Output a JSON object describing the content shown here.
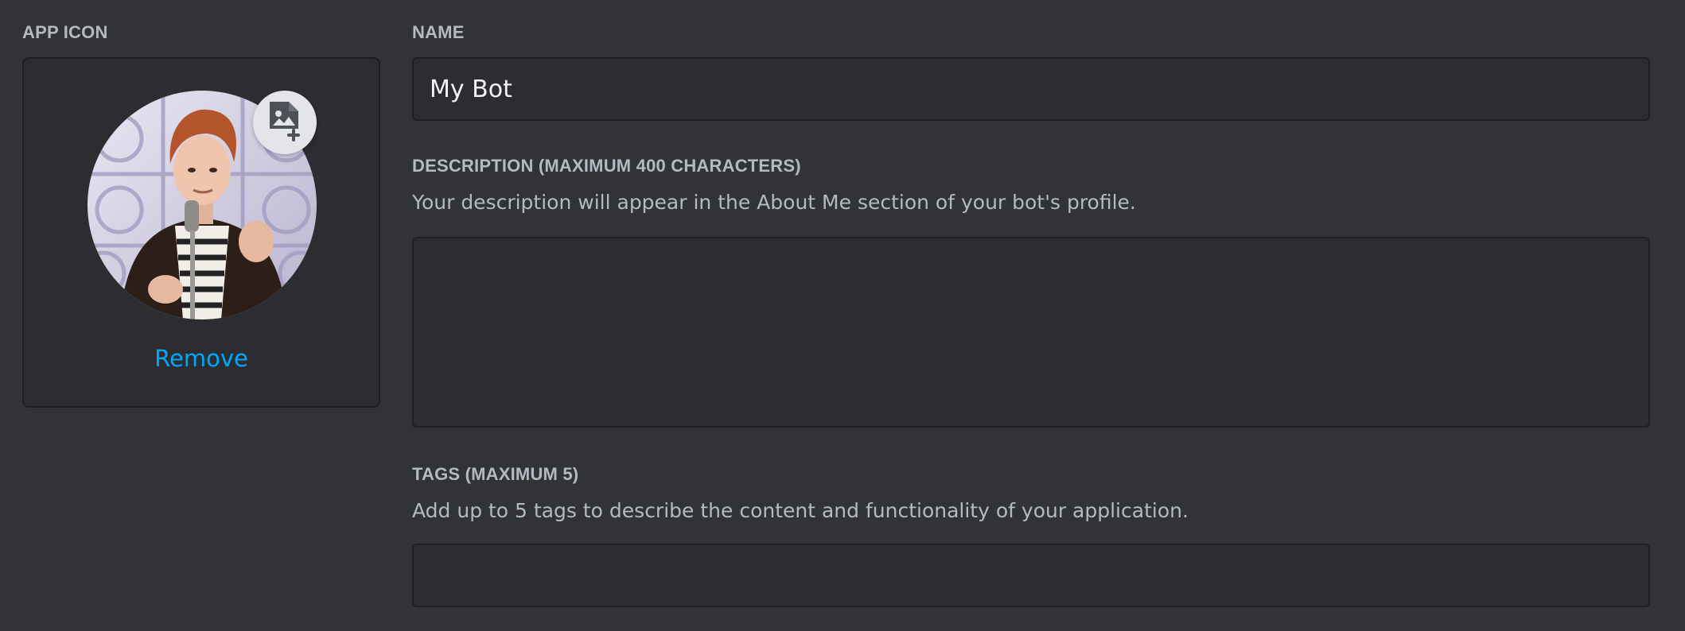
{
  "app_icon": {
    "label": "APP ICON",
    "avatar_icon": "user-avatar-image",
    "upload_icon": "image-add-icon",
    "remove_label": "Remove"
  },
  "name": {
    "label": "NAME",
    "value": "My Bot"
  },
  "description": {
    "label": "DESCRIPTION (MAXIMUM 400 CHARACTERS)",
    "helper": "Your description will appear in the About Me section of your bot's profile.",
    "value": ""
  },
  "tags": {
    "label": "TAGS (MAXIMUM 5)",
    "helper": "Add up to 5 tags to describe the content and functionality of your application.",
    "value": ""
  },
  "colors": {
    "background": "#313338",
    "field_background": "#2b2d31",
    "field_border": "#1e1f22",
    "link": "#00a8fc",
    "label": "#b5bac1"
  }
}
